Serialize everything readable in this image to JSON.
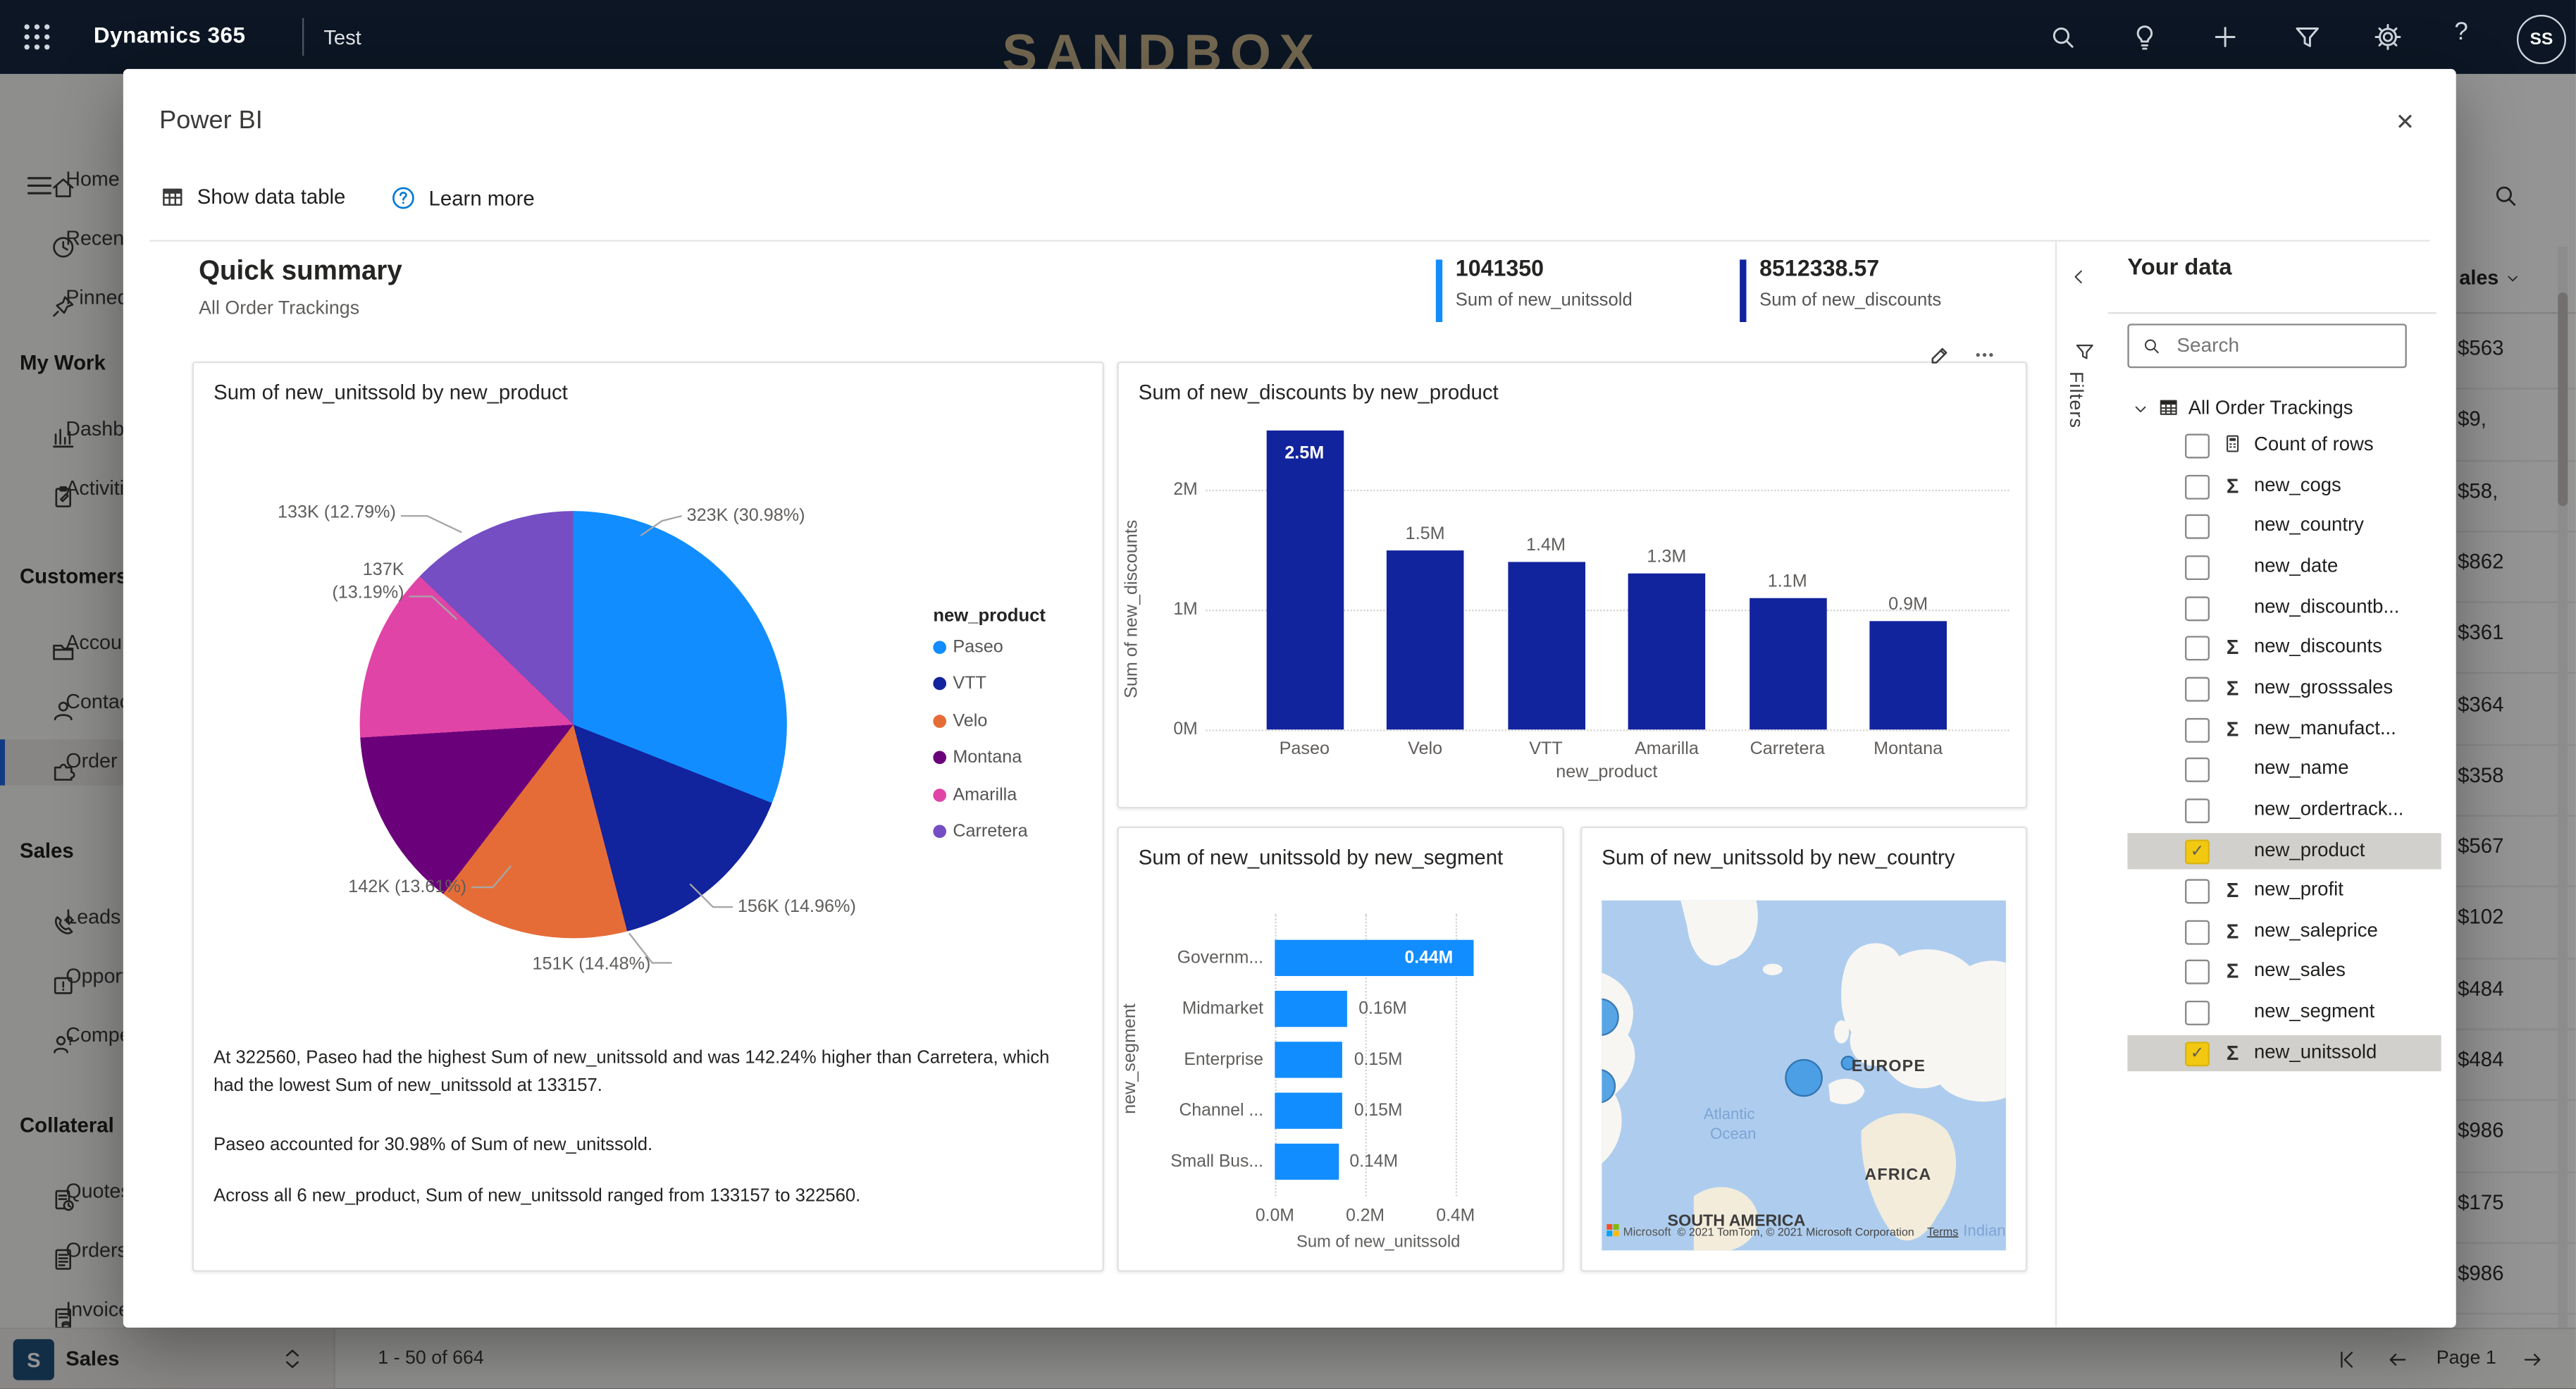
{
  "topbar": {
    "app_title": "Dynamics 365",
    "environment": "Test",
    "watermark": "SANDBOX",
    "avatar_initials": "SS",
    "icons": [
      "search",
      "lightbulb",
      "add",
      "filter",
      "settings",
      "help"
    ]
  },
  "sidebar": {
    "items": [
      {
        "type": "menu",
        "label": "Home",
        "icon": "home"
      },
      {
        "type": "menu",
        "label": "Recent",
        "icon": "clock"
      },
      {
        "type": "menu",
        "label": "Pinned",
        "icon": "pin"
      },
      {
        "type": "section",
        "label": "My Work"
      },
      {
        "type": "menu",
        "label": "Dashboards",
        "icon": "dashboard"
      },
      {
        "type": "menu",
        "label": "Activities",
        "icon": "clipboard"
      },
      {
        "type": "section",
        "label": "Customers"
      },
      {
        "type": "menu",
        "label": "Accounts",
        "icon": "folder"
      },
      {
        "type": "menu",
        "label": "Contacts",
        "icon": "person"
      },
      {
        "type": "menu",
        "label": "Order Trackings",
        "icon": "puzzle",
        "selected": true
      },
      {
        "type": "section",
        "label": "Sales"
      },
      {
        "type": "menu",
        "label": "Leads",
        "icon": "phone"
      },
      {
        "type": "menu",
        "label": "Opportunities",
        "icon": "alert-box"
      },
      {
        "type": "menu",
        "label": "Competitors",
        "icon": "person-question"
      },
      {
        "type": "section",
        "label": "Collateral"
      },
      {
        "type": "menu",
        "label": "Quotes",
        "icon": "doc-clock"
      },
      {
        "type": "menu",
        "label": "Orders",
        "icon": "doc-lines"
      },
      {
        "type": "menu",
        "label": "Invoices",
        "icon": "doc-money"
      }
    ]
  },
  "modal": {
    "title": "Power BI",
    "close_glyph": "✕",
    "toolbar": {
      "show_data_table": "Show data table",
      "learn_more": "Learn more"
    },
    "summary": {
      "title": "Quick summary",
      "subtitle": "All Order Trackings",
      "kpis": [
        {
          "value": "1041350",
          "label": "Sum of new_unitssold",
          "color": "#118DFF"
        },
        {
          "value": "8512338.57",
          "label": "Sum of new_discounts",
          "color": "#12239E"
        }
      ]
    },
    "filters_label": "Filters",
    "narrative": [
      "At 322560, Paseo had the highest Sum of new_unitssold and was 142.24% higher than Carretera, which had the lowest Sum of new_unitssold at 133157.",
      "Paseo accounted for 30.98% of Sum of new_unitssold.",
      "Across all 6 new_product, Sum of new_unitssold ranged from 133157 to 322560."
    ]
  },
  "chart_data": [
    {
      "type": "pie",
      "title": "Sum of new_unitssold by new_product",
      "legend_title": "new_product",
      "legend_position": "right",
      "categories": [
        "Paseo",
        "VTT",
        "Velo",
        "Montana",
        "Amarilla",
        "Carretera"
      ],
      "values": [
        322560,
        155786,
        150787,
        141728,
        137332,
        133157
      ],
      "percents": [
        30.98,
        14.96,
        14.48,
        13.61,
        13.19,
        12.79
      ],
      "labels": [
        "323K (30.98%)",
        "156K (14.96%)",
        "151K (14.48%)",
        "142K (13.61%)",
        "137K (13.19%)",
        "133K (12.79%)"
      ],
      "colors": [
        "#118DFF",
        "#12239E",
        "#E66C37",
        "#6B007B",
        "#E044A7",
        "#744EC2"
      ]
    },
    {
      "type": "bar",
      "title": "Sum of new_discounts by new_product",
      "categories": [
        "Paseo",
        "Velo",
        "VTT",
        "Amarilla",
        "Carretera",
        "Montana"
      ],
      "values_millions": [
        2.5,
        1.5,
        1.4,
        1.3,
        1.1,
        0.9
      ],
      "values_label": [
        "2.5M",
        "1.5M",
        "1.4M",
        "1.3M",
        "1.1M",
        "0.9M"
      ],
      "xlabel": "new_product",
      "ylabel": "Sum of new_discounts",
      "yticks": [
        "0M",
        "1M",
        "2M"
      ],
      "ylim_millions": [
        0,
        2.5
      ],
      "color": "#12239E",
      "grid": "dotted-horizontal"
    },
    {
      "type": "bar-horizontal",
      "title": "Sum of new_unitssold by new_segment",
      "categories": [
        "Governm...",
        "Midmarket",
        "Enterprise",
        "Channel ...",
        "Small Bus..."
      ],
      "values_millions": [
        0.44,
        0.16,
        0.15,
        0.15,
        0.14
      ],
      "values_label": [
        "0.44M",
        "0.16M",
        "0.15M",
        "0.15M",
        "0.14M"
      ],
      "xlabel": "Sum of new_unitssold",
      "ylabel": "new_segment",
      "xticks": [
        "0.0M",
        "0.2M",
        "0.4M"
      ],
      "xlim_millions": [
        0,
        0.48
      ],
      "color": "#118DFF",
      "grid": "dotted-vertical"
    },
    {
      "type": "map",
      "title": "Sum of new_unitssold by new_country",
      "region_labels": [
        "EUROPE",
        "AFRICA",
        "SOUTH AMERICA"
      ],
      "ocean_labels": [
        "Atlantic Ocean",
        "Indian"
      ],
      "attribution_brand": "Microsoft",
      "attribution": "© 2021 TomTom, © 2021 Microsoft Corporation",
      "terms_label": "Terms",
      "bubble_color": "#3B97E3"
    }
  ],
  "your_data": {
    "title": "Your data",
    "search_placeholder": "Search",
    "dataset": "All Order Trackings",
    "checked_color": "#F2C811",
    "fields": [
      {
        "label": "Count of rows",
        "icon": "calculator",
        "checked": false
      },
      {
        "label": "new_cogs",
        "icon": "sigma",
        "checked": false
      },
      {
        "label": "new_country",
        "icon": "",
        "checked": false
      },
      {
        "label": "new_date",
        "icon": "",
        "checked": false
      },
      {
        "label": "new_discountb...",
        "icon": "",
        "checked": false
      },
      {
        "label": "new_discounts",
        "icon": "sigma",
        "checked": false
      },
      {
        "label": "new_grosssales",
        "icon": "sigma",
        "checked": false
      },
      {
        "label": "new_manufact...",
        "icon": "sigma",
        "checked": false
      },
      {
        "label": "new_name",
        "icon": "",
        "checked": false
      },
      {
        "label": "new_ordertrack...",
        "icon": "",
        "checked": false
      },
      {
        "label": "new_product",
        "icon": "",
        "checked": true
      },
      {
        "label": "new_profit",
        "icon": "sigma",
        "checked": false
      },
      {
        "label": "new_saleprice",
        "icon": "sigma",
        "checked": false
      },
      {
        "label": "new_sales",
        "icon": "sigma",
        "checked": false
      },
      {
        "label": "new_segment",
        "icon": "",
        "checked": false
      },
      {
        "label": "new_unitssold",
        "icon": "sigma",
        "checked": true
      }
    ]
  },
  "bg_table": {
    "column_header": "ales",
    "values": [
      "$563",
      "$9,",
      "$58,",
      "$862",
      "$361",
      "$364",
      "$358",
      "$567",
      "$102",
      "$484",
      "$484",
      "$986",
      "$175",
      "$986"
    ]
  },
  "bottombar": {
    "area_initial": "S",
    "area_label": "Sales",
    "record_range": "1 - 50 of 664",
    "page_label": "Page 1"
  }
}
